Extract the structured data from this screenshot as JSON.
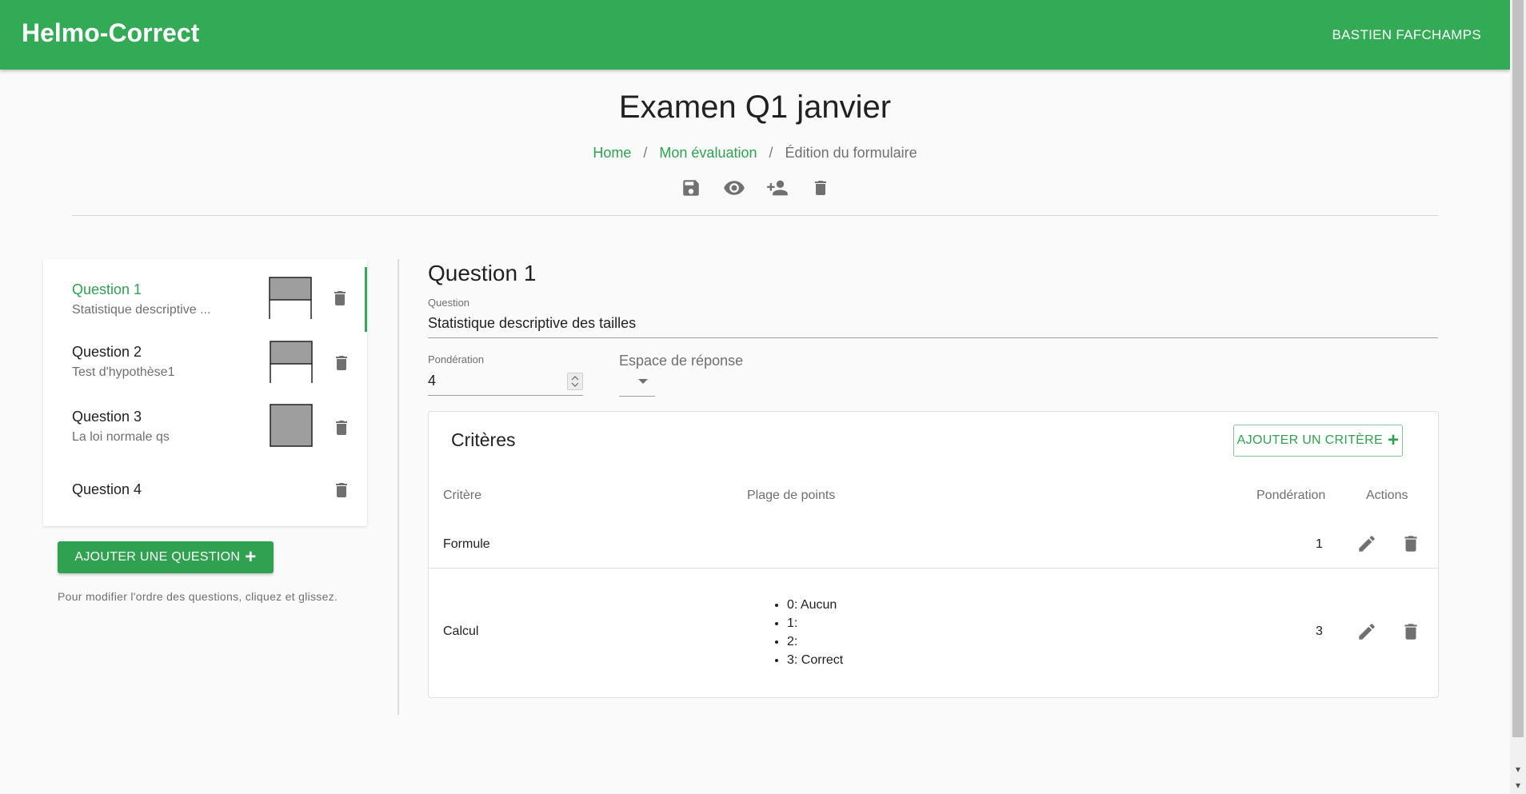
{
  "app": {
    "title": "Helmo-Correct",
    "user": "BASTIEN FAFCHAMPS"
  },
  "page": {
    "title": "Examen Q1 janvier"
  },
  "breadcrumb": {
    "home": "Home",
    "evaluation": "Mon évaluation",
    "current": "Édition du formulaire",
    "separator": "/"
  },
  "toolbar": {
    "icons": [
      "save-icon",
      "eye-icon",
      "person-add-icon",
      "delete-icon"
    ]
  },
  "questions": [
    {
      "title": "Question 1",
      "subtitle": "Statistique descriptive ...",
      "active": true
    },
    {
      "title": "Question 2",
      "subtitle": "Test d'hypothèse1",
      "active": false
    },
    {
      "title": "Question 3",
      "subtitle": "La loi normale qs",
      "active": false
    },
    {
      "title": "Question 4",
      "subtitle": "",
      "active": false
    }
  ],
  "add_question_label": "AJOUTER UNE QUESTION",
  "reorder_hint": "Pour modifier l'ordre des questions, cliquez et glissez.",
  "editor": {
    "heading": "Question 1",
    "question_label": "Question",
    "question_value": "Statistique descriptive des tailles",
    "ponderation_label": "Pondération",
    "ponderation_value": "4",
    "espace_label": "Espace de réponse"
  },
  "criteria": {
    "title": "Critères",
    "add_label": "AJOUTER UN CRITÈRE",
    "columns": [
      "Critère",
      "Plage de points",
      "Pondération",
      "Actions"
    ],
    "rows": [
      {
        "name": "Formule",
        "ranges": [],
        "weight": "1"
      },
      {
        "name": "Calcul",
        "ranges": [
          "0: Aucun",
          "1:",
          "2:",
          "3: Correct"
        ],
        "weight": "3"
      }
    ]
  },
  "colors": {
    "primary": "#33aa55",
    "accent_text": "#2fa151",
    "icon": "#707070"
  }
}
